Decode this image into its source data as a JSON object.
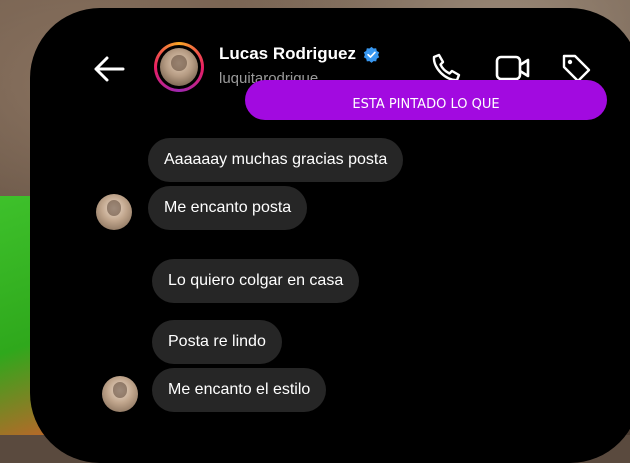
{
  "header": {
    "contact_name": "Lucas Rodriguez",
    "username": "luquitarodrigue",
    "verified": true
  },
  "sent": {
    "partial_text": "ESTA PINTADO LO QUE"
  },
  "messages": [
    {
      "text": "Aaaaaay muchas gracias posta"
    },
    {
      "text": "Me encanto posta"
    },
    {
      "text": "Lo quiero colgar en casa"
    },
    {
      "text": "Posta re lindo"
    },
    {
      "text": "Me encanto el estilo"
    }
  ],
  "colors": {
    "sent_bubble": "#a20ae0",
    "received_bubble": "#262626",
    "verified_badge": "#3897f0",
    "background": "#000000"
  },
  "icons": [
    "back-arrow-icon",
    "verified-icon",
    "phone-call-icon",
    "video-call-icon",
    "tag-icon"
  ]
}
